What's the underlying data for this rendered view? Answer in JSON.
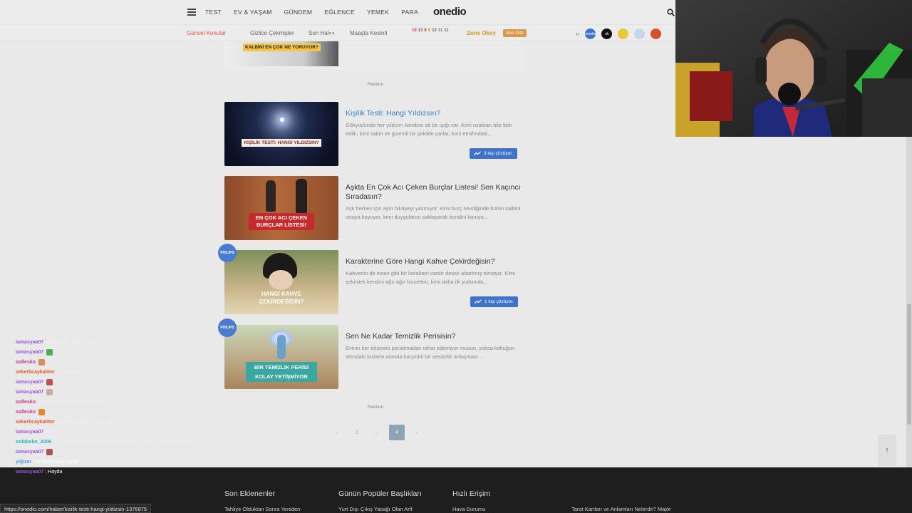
{
  "nav": {
    "links": [
      "TEST",
      "EV & YAŞAM",
      "GÜNDEM",
      "EĞLENCE",
      "YEMEK",
      "PARA"
    ],
    "logo": "onedio"
  },
  "subnav": {
    "hot": "Güncel Konular",
    "links": [
      "Gizlice Çekmişler",
      "Son Hal👀",
      "Maaşta Kesinti"
    ],
    "days": [
      "10",
      "13",
      "8",
      "9",
      "12",
      "11",
      "11"
    ],
    "zone": "Zone Okey",
    "seri": "Seri Düz",
    "circles": [
      "onedio",
      "ok",
      "",
      "",
      "",
      ""
    ]
  },
  "top_thumb_text": "KALBİNİ EN ÇOK NE YORUYOR?",
  "reklam": "Reklam",
  "cards": [
    {
      "title": "Kişilik Testi: Hangi Yıldızsın?",
      "desc": "Gökyüzünde her yıldızın kendine ait bir ışığı var. Kimi uzaktan bile fark edilir, kimi sakin ve gizemli bir şekilde parlar, kimi etrafındaki...",
      "thumb_text": "KİŞİLİK TESTİ: HANGİ YILDIZSIN?",
      "badge": "3 kişi çözüyor."
    },
    {
      "title": "Aşkta En Çok Acı Çeken Burçlar Listesi! Sen Kaçıncı Sıradasın?",
      "desc": "Aşk herkes için aynı hikâyeyi yazmıyor. Kimi burç sevdiğinde bütün kalbini ortaya koyuyor, kimi duygularını saklayarak kendini koruyo...",
      "thumb_text": "EN ÇOK ACI ÇEKEN BURÇLAR LİSTESİ!"
    },
    {
      "title": "Karakterine Göre Hangi Kahve Çekirdeğisin?",
      "desc": "Kahvenin de insan gibi bir karakteri vardır desek abartmış olmayız. Kimi çekirdek kendini ağır ağır hissettirir, kimi daha ilk yudumda...",
      "thumb_text": "HANGİ KAHVE ÇEKİRDEĞİSİN?",
      "badge": "1 kişi çözüyor.",
      "sponsor": "PHILIPS"
    },
    {
      "title": "Sen Ne Kadar Temizlik Perisisin?",
      "desc": "Evinin her köşesini parlatmadan rahat edemiyor musun, yoksa koltuğun altındaki tozlarla aranda karşılıklı bir sessizlik anlaşması ...",
      "thumb_text": "BİR TEMİZLİK PERİSİ KOLAY YETİŞMİYOR",
      "sponsor": "PHILIPS"
    }
  ],
  "pager": {
    "prev": "‹",
    "pages": [
      "1",
      "...",
      "4"
    ],
    "next": "›"
  },
  "footer": {
    "headings": [
      "Son Eklenenler",
      "Günün Popüler Başlıkları",
      "Hızlı Erişim"
    ],
    "links": [
      "Tahliye Olduktan Sonra Yeniden",
      "Yurt Dışı Çıkış Yasağı Olan Arif",
      "Hava Durumu",
      "Tarot Kartları ve Anlamları Nelerdir? Majör"
    ]
  },
  "status_url": "https://onedio.com/haber/kisilik-testi-hangi-yildizsin-1376875",
  "chat": [
    {
      "user": "iamasyaa07",
      "color": "#9b59d6",
      "msg": "Adam çare var 1 duruyor"
    },
    {
      "user": "iamasyaa07",
      "color": "#9b59d6",
      "msg": "",
      "emote": "#4caf50"
    },
    {
      "user": "sollesko",
      "color": "#c0398a",
      "msg": "",
      "emote": "#d98a5e"
    },
    {
      "user": "sekerlicaykahter",
      "color": "#e05a2a",
      "msg": "abisiye abes nerme"
    },
    {
      "user": "iamasyaa07",
      "color": "#9b59d6",
      "msg": "",
      "emote": "#b55"
    },
    {
      "user": "iamasyaa07",
      "color": "#9b59d6",
      "msg": "",
      "emote": "#caa"
    },
    {
      "user": "sollesko",
      "color": "#c0398a",
      "msg": "çok oyle ama uyan yokmuyuz"
    },
    {
      "user": "sollesko",
      "color": "#c0398a",
      "msg": "",
      "emote": "#e08a2a"
    },
    {
      "user": "sekerlicaykahter",
      "color": "#e05a2a",
      "msg": "herkes yalan deyor o abiıı"
    },
    {
      "user": "iamasyaa07",
      "color": "#9b59d6",
      "msg": "Tolga Ayaz'ın Uzenum Yıldız'la aşı kısım açsanız abi"
    },
    {
      "user": "onlabebe_2006",
      "color": "#2bb5c4",
      "msg": "işimeli kalsin bilgi testi gerçekmiş ne diyor bu bey üyle allah işi"
    },
    {
      "user": "iamasyaa07",
      "color": "#9b59d6",
      "msg": "",
      "emote": "#a55"
    },
    {
      "user": "yiğizm",
      "color": "#4aa3e0",
      "msg": "as favori şarkı geldi"
    },
    {
      "user": "iamasyaa07",
      "color": "#9b59d6",
      "msg": "Hayda"
    }
  ]
}
